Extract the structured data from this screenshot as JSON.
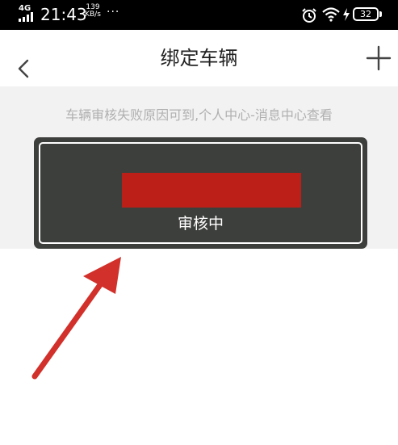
{
  "status_bar": {
    "network": "4G",
    "time": "21:43",
    "speed_value": "139",
    "speed_unit": "KB/s",
    "more": "···",
    "battery": "32"
  },
  "header": {
    "title": "绑定车辆",
    "back_icon": "chevron-left-icon",
    "add_icon": "plus-icon"
  },
  "notice": {
    "text": "车辆审核失败原因可到,个人中心-消息中心查看"
  },
  "vehicle_card": {
    "status": "审核中",
    "plate_redaction_color": "#bb1f17"
  },
  "annotation": {
    "arrow_color": "#d2302a"
  }
}
